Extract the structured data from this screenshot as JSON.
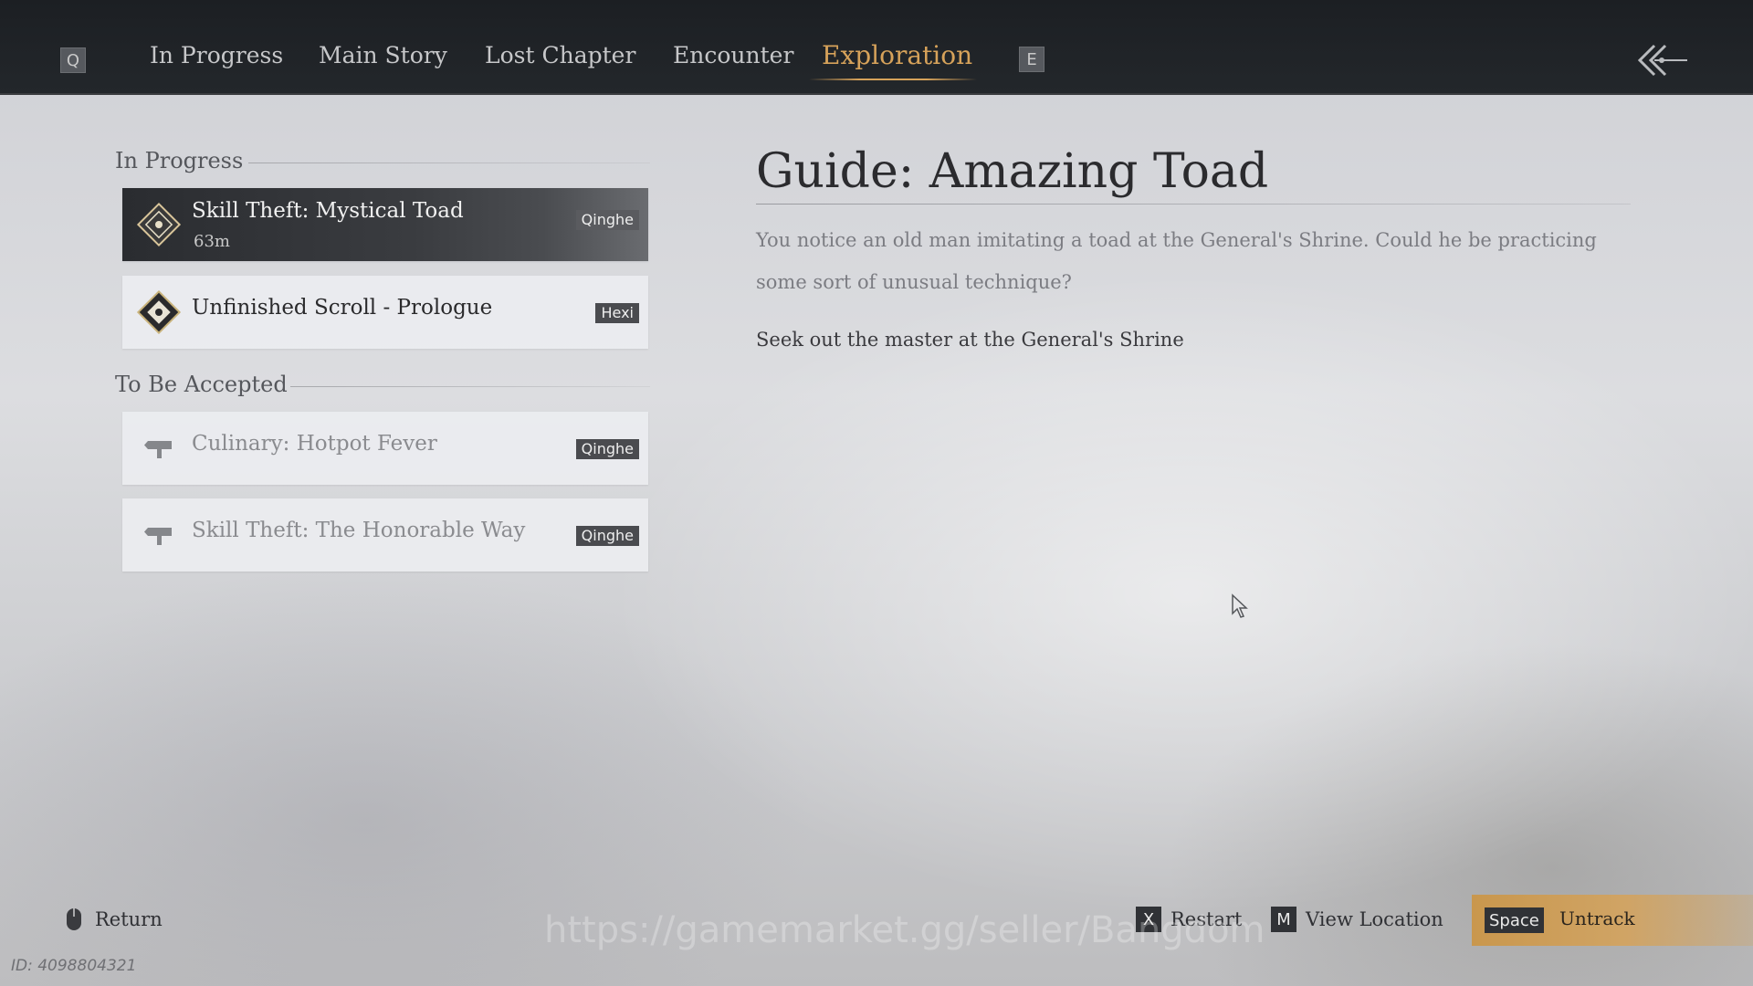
{
  "nav": {
    "left_key": "Q",
    "right_key": "E",
    "tabs": [
      {
        "label": "In Progress",
        "active": false
      },
      {
        "label": "Main Story",
        "active": false
      },
      {
        "label": "Lost Chapter",
        "active": false
      },
      {
        "label": "Encounter",
        "active": false
      },
      {
        "label": "Exploration",
        "active": true
      }
    ],
    "back_icon": "double-chevron-left-arrow-icon"
  },
  "sections": {
    "in_progress": {
      "label": "In Progress",
      "quests": [
        {
          "title": "Skill Theft: Mystical Toad",
          "distance": "63m",
          "region": "Qinghe",
          "selected": true,
          "icon": "diamond-quest-icon"
        },
        {
          "title": "Unfinished Scroll - Prologue",
          "region": "Hexi",
          "selected": false,
          "icon": "diamond-quest-icon"
        }
      ]
    },
    "to_be_accepted": {
      "label": "To Be Accepted",
      "quests": [
        {
          "title": "Culinary: Hotpot Fever",
          "region": "Qinghe",
          "icon": "signpost-icon"
        },
        {
          "title": "Skill Theft: The Honorable Way",
          "region": "Qinghe",
          "icon": "signpost-icon"
        }
      ]
    }
  },
  "detail": {
    "title": "Guide: Amazing Toad",
    "description": "You notice an old man imitating a toad at the General's Shrine. Could he be practicing some sort of unusual technique?",
    "objective": "Seek out the master at the General's Shrine"
  },
  "footer": {
    "return_label": "Return",
    "restart_key": "X",
    "restart_label": "Restart",
    "view_key": "M",
    "view_label": "View Location",
    "untrack_key": "Space",
    "untrack_label": "Untrack"
  },
  "watermark": "https://gamemarket.gg/seller/Bangdom",
  "id_text": "ID: 4098804321",
  "colors": {
    "accent": "#d6a25a",
    "nav_bg": "#1c1f23",
    "untrack_bar": "#c9974d"
  }
}
